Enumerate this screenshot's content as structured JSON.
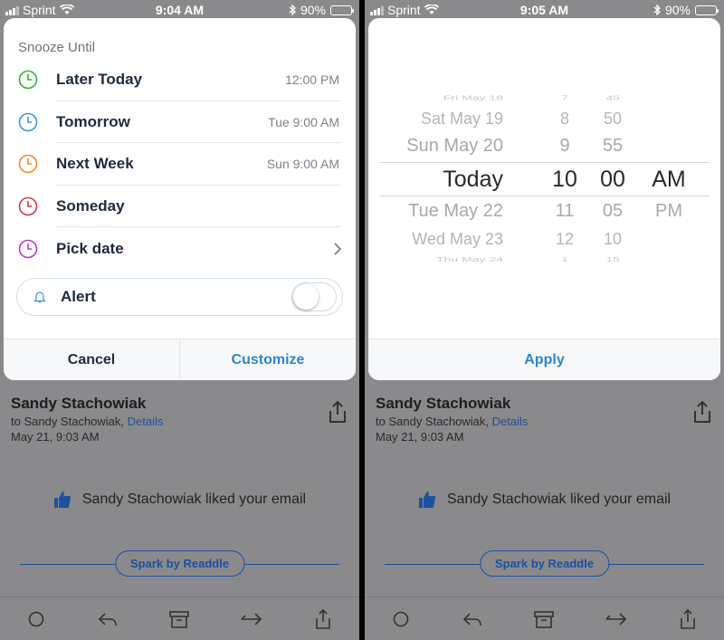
{
  "left": {
    "status": {
      "carrier": "Sprint",
      "time": "9:04 AM",
      "battery": "90%"
    },
    "sheet": {
      "title": "Snooze Until",
      "options": [
        {
          "label": "Later Today",
          "time": "12:00 PM",
          "color": "#2eb82e"
        },
        {
          "label": "Tomorrow",
          "time": "Tue 9:00 AM",
          "color": "#3a9ad9"
        },
        {
          "label": "Next Week",
          "time": "Sun 9:00 AM",
          "color": "#f08a24"
        },
        {
          "label": "Someday",
          "time": "",
          "color": "#d9344a"
        },
        {
          "label": "Pick date",
          "time": "",
          "color": "#b43cc8"
        }
      ],
      "alert_label": "Alert",
      "alert_on": false,
      "cancel_label": "Cancel",
      "customize_label": "Customize"
    }
  },
  "right": {
    "status": {
      "carrier": "Sprint",
      "time": "9:05 AM",
      "battery": "90%"
    },
    "picker": {
      "days": [
        "Fri May 18",
        "Sat May 19",
        "Sun May 20",
        "Today",
        "Tue May 22",
        "Wed May 23",
        "Thu May 24"
      ],
      "hours": [
        "7",
        "8",
        "9",
        "10",
        "11",
        "12",
        "1"
      ],
      "minutes": [
        "45",
        "50",
        "55",
        "00",
        "05",
        "10",
        "15"
      ],
      "ampm": [
        "AM",
        "PM"
      ]
    },
    "apply_label": "Apply"
  },
  "email": {
    "sender": "Sandy Stachowiak",
    "to_prefix": "to Sandy Stachowiak, ",
    "details_link": "Details",
    "date": "May 21, 9:03 AM",
    "liked_text": "Sandy Stachowiak liked your email",
    "spark_label": "Spark by Readdle"
  },
  "colors": {
    "accent": "#2f86c9",
    "link": "#1f4fa0",
    "dim_overlay": "#8a8a8c"
  }
}
